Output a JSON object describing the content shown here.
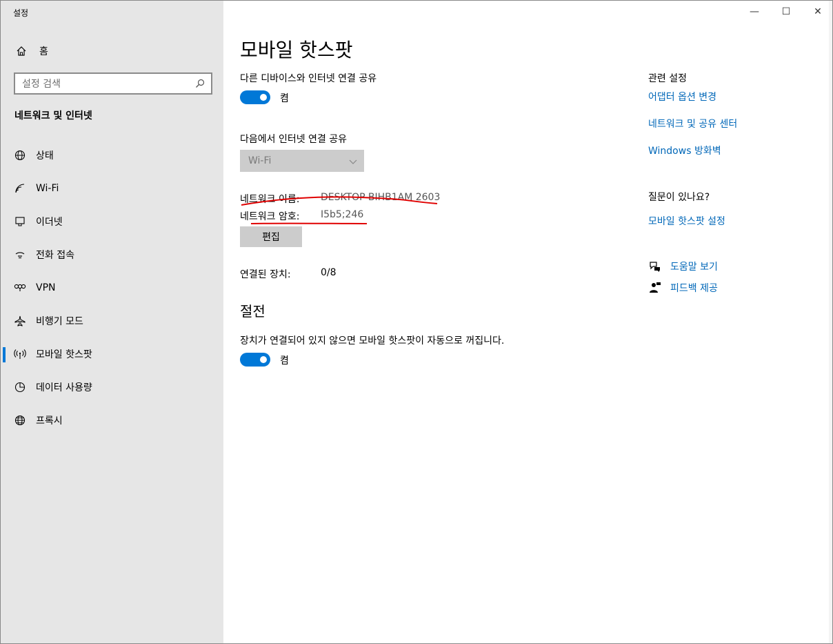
{
  "app": {
    "title": "설정"
  },
  "window_controls": {
    "minimize": "—",
    "maximize": "☐",
    "close": "✕"
  },
  "sidebar": {
    "home_label": "홈",
    "search_placeholder": "설정 검색",
    "section_title": "네트워크 및 인터넷",
    "items": [
      {
        "label": "상태",
        "icon": "status-globe-icon"
      },
      {
        "label": "Wi-Fi",
        "icon": "wifi-icon"
      },
      {
        "label": "이더넷",
        "icon": "ethernet-icon"
      },
      {
        "label": "전화 접속",
        "icon": "dialup-icon"
      },
      {
        "label": "VPN",
        "icon": "vpn-icon"
      },
      {
        "label": "비행기 모드",
        "icon": "airplane-icon"
      },
      {
        "label": "모바일 핫스팟",
        "icon": "hotspot-icon",
        "active": true
      },
      {
        "label": "데이터 사용량",
        "icon": "data-usage-icon"
      },
      {
        "label": "프록시",
        "icon": "proxy-globe-icon"
      }
    ]
  },
  "main": {
    "title": "모바일 핫스팟",
    "share_label": "다른 디바이스와 인터넷 연결 공유",
    "share_state": "켬",
    "share_from_label": "다음에서 인터넷 연결 공유",
    "share_from_value": "Wi-Fi",
    "network_name_label": "네트워크 이름:",
    "network_name_value": "DESKTOP-BIHB1AM 2603",
    "network_password_label": "네트워크 암호:",
    "network_password_value": "I5b5;246",
    "edit_button": "편집",
    "connected_label": "연결된 장치:",
    "connected_value": "0/8",
    "power_heading": "절전",
    "power_desc": "장치가 연결되어 있지 않으면 모바일 핫스팟이 자동으로 꺼집니다.",
    "power_state": "켬"
  },
  "related": {
    "heading": "관련 설정",
    "links": [
      "어댑터 옵션 변경",
      "네트워크 및 공유 센터",
      "Windows 방화벽"
    ],
    "question_heading": "질문이 있나요?",
    "question_link": "모바일 핫스팟 설정",
    "help_label": "도움말 보기",
    "feedback_label": "피드백 제공"
  },
  "colors": {
    "accent": "#0078d7",
    "link": "#0067b8",
    "annotation": "#e00000",
    "sidebar_bg": "#e6e6e6"
  }
}
